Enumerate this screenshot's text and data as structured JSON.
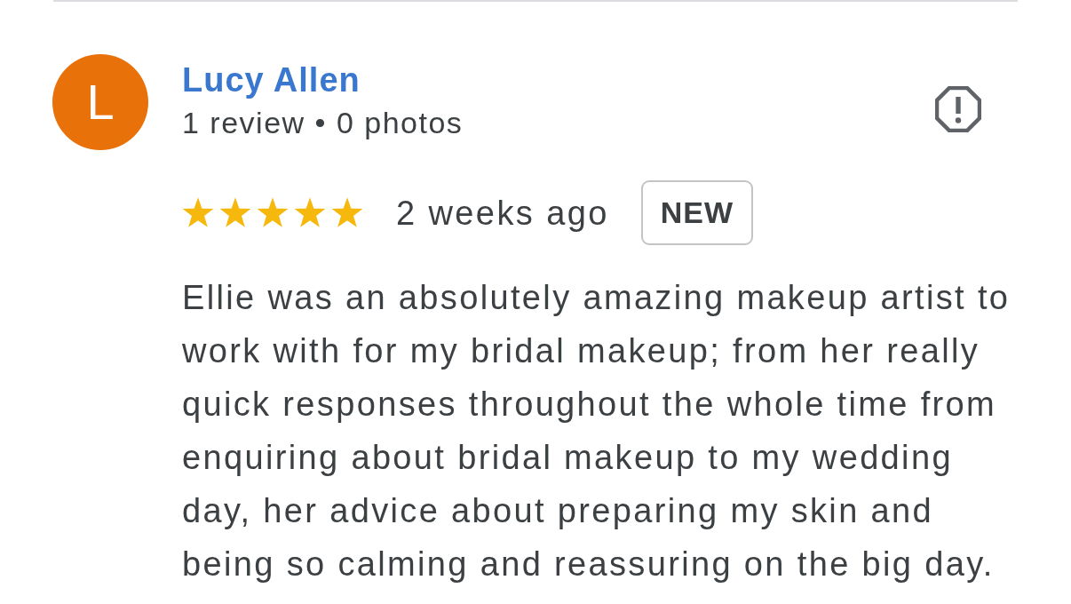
{
  "review": {
    "author": {
      "initial": "L",
      "name": "Lucy Allen",
      "stats": "1 review • 0 photos"
    },
    "stars": 5,
    "time": "2 weeks ago",
    "badge": "NEW",
    "text": "Ellie was an absolutely amazing makeup artist to work with for my bridal makeup; from her really quick responses throughout the whole time from enquiring about bridal makeup to my wedding day, her advice about preparing my skin and being so calming and reassuring on the big day."
  }
}
